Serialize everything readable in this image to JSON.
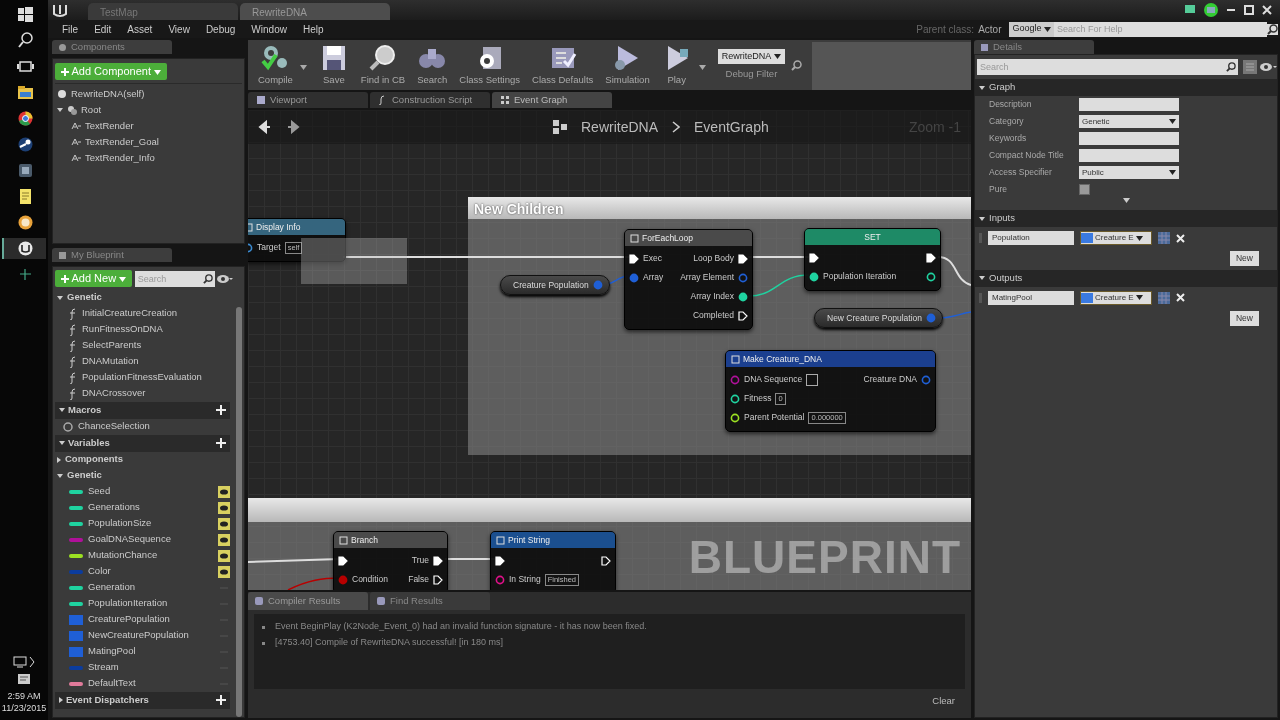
{
  "taskbar": {
    "apps": [
      {
        "selected": false
      },
      {
        "selected": false
      },
      {
        "selected": false
      },
      {
        "selected": false
      },
      {
        "selected": false
      },
      {
        "selected": false
      },
      {
        "selected": false
      },
      {
        "selected": false
      },
      {
        "selected": false
      },
      {
        "selected": true
      },
      {
        "selected": false
      }
    ],
    "clock": {
      "time": "2:59 AM",
      "date": "11/23/2015"
    }
  },
  "document_tabs": [
    {
      "label": "TestMap",
      "selected": false
    },
    {
      "label": "RewriteDNA",
      "selected": true
    }
  ],
  "menu": [
    "File",
    "Edit",
    "Asset",
    "View",
    "Debug",
    "Window",
    "Help"
  ],
  "parent_class": {
    "label": "Parent class:",
    "value": "Actor"
  },
  "help_search": {
    "engine": "Google",
    "placeholder": "Search For Help"
  },
  "components": {
    "tab": "Components",
    "add_button": "Add Component",
    "tree": [
      {
        "label": "RewriteDNA(self)",
        "kind": "actor"
      },
      {
        "label": "Root",
        "kind": "scene",
        "expanded": true,
        "children": [
          {
            "label": "TextRender",
            "kind": "text"
          },
          {
            "label": "TextRender_Goal",
            "kind": "text"
          },
          {
            "label": "TextRender_Info",
            "kind": "text"
          }
        ]
      }
    ]
  },
  "my_blueprint": {
    "tab": "My Blueprint",
    "add_button": "Add New",
    "search_placeholder": "Search",
    "sections": [
      {
        "kind": "category",
        "title": "Genetic",
        "expanded": true,
        "items": [
          {
            "label": "InitialCreatureCreation",
            "kind": "function"
          },
          {
            "label": "RunFitnessOnDNA",
            "kind": "function"
          },
          {
            "label": "SelectParents",
            "kind": "function"
          },
          {
            "label": "DNAMutation",
            "kind": "function"
          },
          {
            "label": "PopulationFitnessEvaluation",
            "kind": "function"
          },
          {
            "label": "DNACrossover",
            "kind": "function"
          }
        ]
      },
      {
        "kind": "header",
        "title": "Macros",
        "expanded": true,
        "items": [
          {
            "label": "ChanceSelection",
            "kind": "macro"
          }
        ]
      },
      {
        "kind": "header",
        "title": "Variables",
        "expanded": true
      },
      {
        "kind": "category",
        "title": "Components",
        "expanded": false
      },
      {
        "kind": "category",
        "title": "Genetic",
        "expanded": true,
        "items": [
          {
            "label": "Seed",
            "kind": "variable",
            "color": "#1fd3a0",
            "public": true
          },
          {
            "label": "Generations",
            "kind": "variable",
            "color": "#1fd3a0",
            "public": true
          },
          {
            "label": "PopulationSize",
            "kind": "variable",
            "color": "#1fd3a0",
            "public": true
          },
          {
            "label": "GoalDNASequence",
            "kind": "variable",
            "color": "#b0109a",
            "public": true
          },
          {
            "label": "MutationChance",
            "kind": "variable",
            "color": "#9be022",
            "public": true
          },
          {
            "label": "Color",
            "kind": "variable",
            "color": "#0b3c9e",
            "public": true
          },
          {
            "label": "Generation",
            "kind": "variable",
            "color": "#1fd3a0",
            "public": false
          },
          {
            "label": "PopulationIteration",
            "kind": "variable",
            "color": "#1fd3a0",
            "public": false
          },
          {
            "label": "CreaturePopulation",
            "kind": "array",
            "color": "#1f5fd6",
            "public": false
          },
          {
            "label": "NewCreaturePopulation",
            "kind": "array",
            "color": "#1f5fd6",
            "public": false
          },
          {
            "label": "MatingPool",
            "kind": "array",
            "color": "#1f5fd6",
            "public": false
          },
          {
            "label": "Stream",
            "kind": "variable",
            "color": "#0b3c9e",
            "public": false
          },
          {
            "label": "DefaultText",
            "kind": "variable",
            "color": "#e07a9a",
            "public": false
          }
        ]
      },
      {
        "kind": "header",
        "title": "Event Dispatchers",
        "expanded": false
      }
    ]
  },
  "toolbar": {
    "buttons": [
      {
        "label": "Compile",
        "dropdown": true
      },
      {
        "label": "Save",
        "dropdown": false
      },
      {
        "label": "Find in CB",
        "dropdown": false
      },
      {
        "label": "Search",
        "dropdown": false
      },
      {
        "label": "Class Settings",
        "dropdown": false
      },
      {
        "label": "Class Defaults",
        "dropdown": false
      },
      {
        "label": "Simulation",
        "dropdown": false
      },
      {
        "label": "Play",
        "dropdown": true
      }
    ],
    "debug_filter": {
      "value": "RewriteDNA",
      "label": "Debug Filter"
    }
  },
  "editor_tabs": [
    {
      "label": "Viewport",
      "selected": false
    },
    {
      "label": "Construction Script",
      "selected": false
    },
    {
      "label": "Event Graph",
      "selected": true
    }
  ],
  "graph": {
    "breadcrumb": [
      "RewriteDNA",
      "EventGraph"
    ],
    "zoom": "Zoom -1",
    "watermark": "BLUEPRINT",
    "comments": [
      {
        "title": "New Children"
      }
    ],
    "nodes": [
      {
        "kind": "function",
        "title": "Display Info",
        "color": "#35657e",
        "rows": [
          {
            "left": {
              "label": "Target",
              "kind": "data",
              "color": "#3a8ad0",
              "linked": false,
              "value": "self"
            }
          }
        ]
      },
      {
        "kind": "function",
        "title": "ForEachLoop",
        "color": "#4a4a4a",
        "rows": [
          {
            "left": {
              "label": "Exec",
              "kind": "exec",
              "linked": true
            },
            "right": {
              "label": "Loop Body",
              "kind": "exec",
              "linked": true
            }
          },
          {
            "left": {
              "label": "Array",
              "kind": "data",
              "color": "#1f5fd6",
              "linked": true
            },
            "right": {
              "label": "Array Element",
              "kind": "data",
              "color": "#1f5fd6",
              "linked": false
            }
          },
          {
            "right": {
              "label": "Array Index",
              "kind": "data",
              "color": "#1fd3a0",
              "linked": true
            }
          },
          {
            "right": {
              "label": "Completed",
              "kind": "exec",
              "linked": false
            }
          }
        ]
      },
      {
        "kind": "set",
        "title": "SET",
        "color": "#1e8a66",
        "rows": [
          {
            "left": {
              "kind": "exec",
              "linked": true
            },
            "right": {
              "kind": "exec",
              "linked": true
            }
          },
          {
            "left": {
              "label": "Population Iteration",
              "kind": "data",
              "color": "#1fd3a0",
              "linked": true
            },
            "right": {
              "kind": "data",
              "color": "#1fd3a0",
              "linked": false
            }
          }
        ]
      },
      {
        "kind": "getter",
        "title": "Creature Population",
        "color": "#1f5fd6"
      },
      {
        "kind": "getter",
        "title": "New Creature Population",
        "color": "#1f5fd6"
      },
      {
        "kind": "function",
        "title": "Make Creature_DNA",
        "color": "#1b3f8f",
        "rows": [
          {
            "left": {
              "label": "DNA Sequence",
              "kind": "data",
              "color": "#b0109a",
              "linked": false,
              "input_box": true
            },
            "right": {
              "label": "Creature DNA",
              "kind": "data",
              "color": "#1f5fd6",
              "linked": false
            }
          },
          {
            "left": {
              "label": "Fitness",
              "kind": "data",
              "color": "#1fd3a0",
              "linked": false,
              "value": "0"
            }
          },
          {
            "left": {
              "label": "Parent Potential",
              "kind": "data",
              "color": "#9be022",
              "linked": false,
              "value": "0.000000"
            }
          }
        ]
      },
      {
        "kind": "function",
        "title": "Branch",
        "color": "#4a4a4a",
        "rows": [
          {
            "left": {
              "kind": "exec",
              "linked": true
            },
            "right": {
              "label": "True",
              "kind": "exec",
              "linked": true
            }
          },
          {
            "left": {
              "label": "Condition",
              "kind": "data",
              "color": "#b80000",
              "linked": true
            },
            "right": {
              "label": "False",
              "kind": "exec",
              "linked": false
            }
          }
        ]
      },
      {
        "kind": "function",
        "title": "Print String",
        "color": "#1b4f8f",
        "rows": [
          {
            "left": {
              "kind": "exec",
              "linked": true
            },
            "right": {
              "kind": "exec",
              "linked": false
            }
          },
          {
            "left": {
              "label": "In String",
              "kind": "data",
              "color": "#e0108a",
              "linked": false,
              "value": "Finished"
            }
          }
        ]
      }
    ]
  },
  "results": {
    "tabs": [
      {
        "label": "Compiler Results",
        "selected": true
      },
      {
        "label": "Find Results",
        "selected": false
      }
    ],
    "messages": [
      "Event BeginPlay (K2Node_Event_0) had an invalid function signature - it has now been fixed.",
      "[4753.40] Compile of RewriteDNA successful! [in 180 ms]"
    ],
    "clear_button": "Clear"
  },
  "details": {
    "tab": "Details",
    "search_placeholder": "Search",
    "graph_section": {
      "title": "Graph",
      "expanded": true,
      "rows": [
        {
          "label": "Description",
          "kind": "text"
        },
        {
          "label": "Category",
          "kind": "combo",
          "value": "Genetic"
        },
        {
          "label": "Keywords",
          "kind": "text"
        },
        {
          "label": "Compact Node Title",
          "kind": "text"
        },
        {
          "label": "Access Specifier",
          "kind": "select",
          "value": "Public"
        },
        {
          "label": "Pure",
          "kind": "checkbox",
          "checked": false
        }
      ]
    },
    "param_sections": [
      {
        "title": "Inputs",
        "expanded": true,
        "params": [
          {
            "name": "Population",
            "type": "Creature E"
          }
        ],
        "button": "New"
      },
      {
        "title": "Outputs",
        "expanded": true,
        "params": [
          {
            "name": "MatingPool",
            "type": "Creature E"
          }
        ],
        "button": "New"
      }
    ]
  }
}
